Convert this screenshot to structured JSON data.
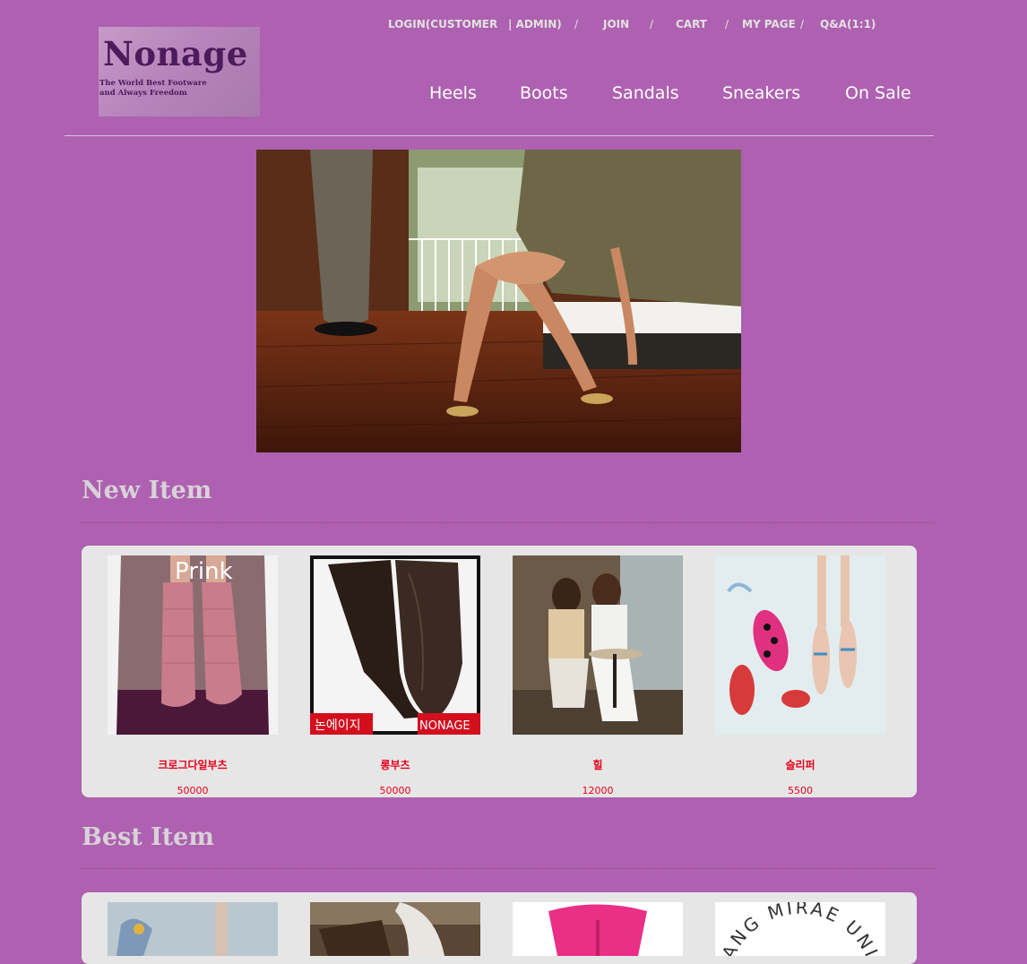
{
  "colors": {
    "background": "#ae61b0",
    "nav_text": "#e2e2e2",
    "section_title": "#d8d2d8",
    "box_background": "#e6e6e6",
    "item_text": "#e8001c"
  },
  "top_nav": {
    "login": "LOGIN(CUSTOMER",
    "admin": "| ADMIN)",
    "sep": "/",
    "join": "JOIN",
    "cart": "CART",
    "mypage": "MY PAGE",
    "qna": "Q&A(1:1)"
  },
  "logo": {
    "name": "Nonage",
    "tagline_1": "The World Best Footware",
    "tagline_2": "and Always Freedom"
  },
  "categories": [
    "Heels",
    "Boots",
    "Sandals",
    "Sneakers",
    "On Sale"
  ],
  "sections": {
    "new_title": "New Item",
    "best_title": "Best Item"
  },
  "new_items": [
    {
      "name": "크로그다일부츠",
      "price": "50000",
      "badge": "Prink"
    },
    {
      "name": "롱부츠",
      "price": "50000",
      "badge_left": "논에이지",
      "badge_right": "NONAGE"
    },
    {
      "name": "힐",
      "price": "12000"
    },
    {
      "name": "슬리퍼",
      "price": "5500"
    }
  ],
  "best_items": [
    {
      "name": "",
      "price": ""
    },
    {
      "name": "",
      "price": ""
    },
    {
      "name": "",
      "price": ""
    },
    {
      "name": "",
      "price": "",
      "seal_text": "ANG MIRAE UNIV"
    }
  ]
}
